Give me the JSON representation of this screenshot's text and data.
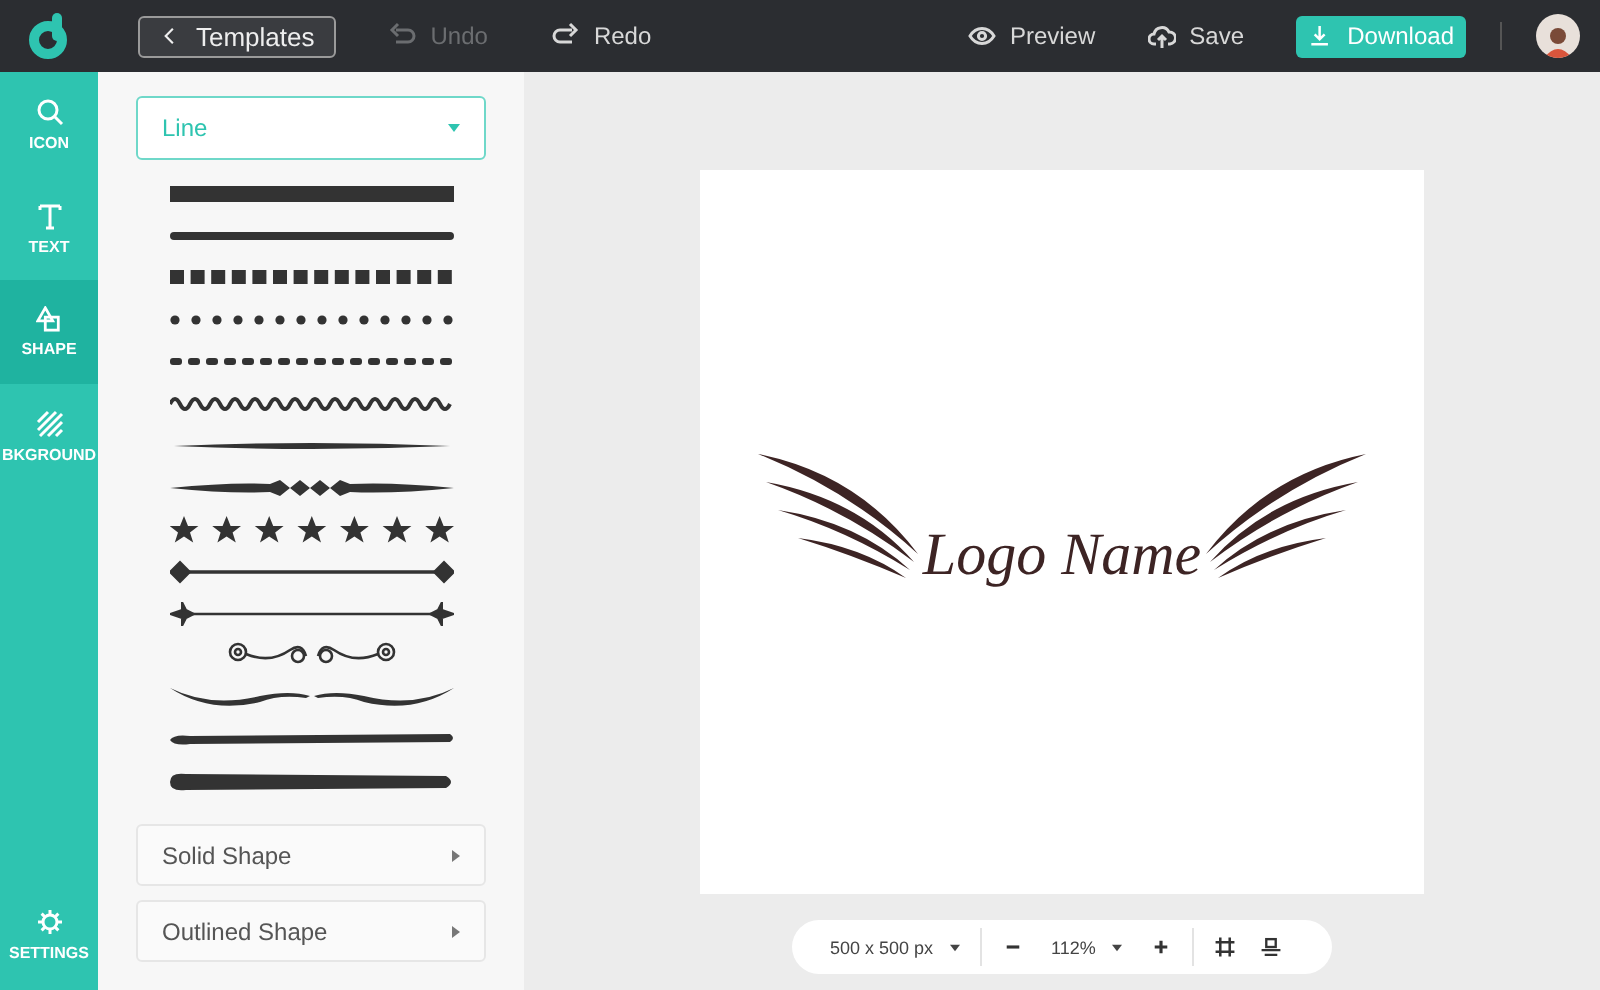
{
  "toolbar": {
    "back": {
      "label": "Templates"
    },
    "actions": [
      {
        "kind": "undo",
        "label": "Undo",
        "disabled": true
      },
      {
        "kind": "redo",
        "label": "Redo",
        "disabled": false
      }
    ],
    "right_actions": [
      {
        "kind": "preview",
        "label": "Preview"
      },
      {
        "kind": "save",
        "label": "Save"
      }
    ],
    "download": {
      "label": "Download"
    }
  },
  "rail": {
    "items": [
      {
        "kind": "search",
        "label": "ICON",
        "selected": false
      },
      {
        "kind": "text",
        "label": "TEXT",
        "selected": false
      },
      {
        "kind": "shape",
        "label": "SHAPE",
        "selected": true
      },
      {
        "kind": "background",
        "label": "BKGROUND",
        "selected": false
      }
    ],
    "settings": {
      "label": "SETTINGS"
    }
  },
  "panel": {
    "dropdown": {
      "value": "Line"
    },
    "sections": [
      {
        "label": "Solid Shape"
      },
      {
        "label": "Outlined Shape"
      }
    ]
  },
  "canvas": {
    "logo_text": "Logo Name"
  },
  "zoom_bar": {
    "size": "500 x 500 px",
    "zoom": "112%"
  }
}
